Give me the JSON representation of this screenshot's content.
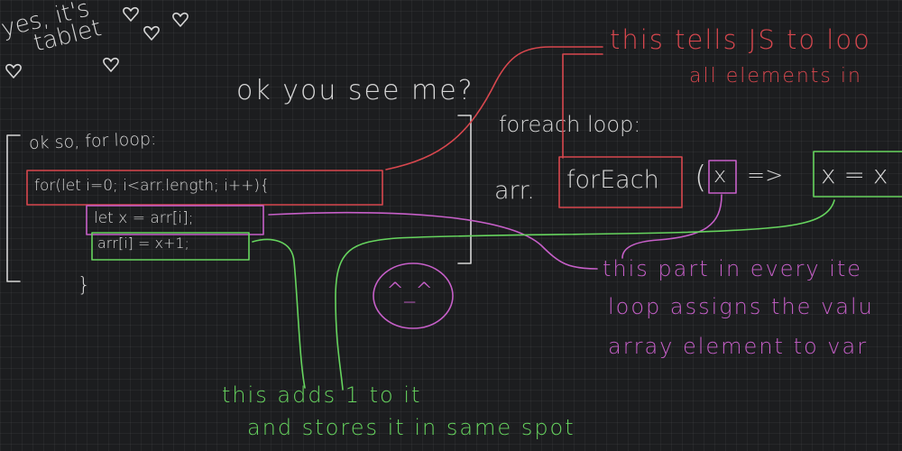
{
  "colors": {
    "background": "#1c1d1f",
    "white_ink": "#d6d6d6",
    "red_ink": "#d8474e",
    "pink_ink": "#c65fc8",
    "green_ink": "#66d45e"
  },
  "doodle": {
    "line1": "yes, it's",
    "line2": "tablet",
    "hearts": [
      "heart",
      "heart",
      "heart",
      "heart",
      "heart"
    ]
  },
  "greeting": "ok you see me?",
  "for_loop": {
    "heading": "ok so, for loop:",
    "line1": "for(let i=0; i<arr.length; i++){",
    "line2": "let x = arr[i];",
    "line3": "arr[i] = x+1;",
    "close": "}"
  },
  "foreach_loop": {
    "heading": "foreach loop:",
    "arr": "arr.",
    "method": "forEach",
    "open_paren": "(",
    "param": "x",
    "arrow": "=>",
    "body": "x = x"
  },
  "notes": {
    "red_line1": "this tells JS to loo",
    "red_line2": "all elements in",
    "pink_line1": "this part in every ite",
    "pink_line2": "loop assigns the valu",
    "pink_line3": "array element to var",
    "green_line1": "this adds 1 to it",
    "green_line2": "and stores it in same spot"
  },
  "smiley": "^_^"
}
